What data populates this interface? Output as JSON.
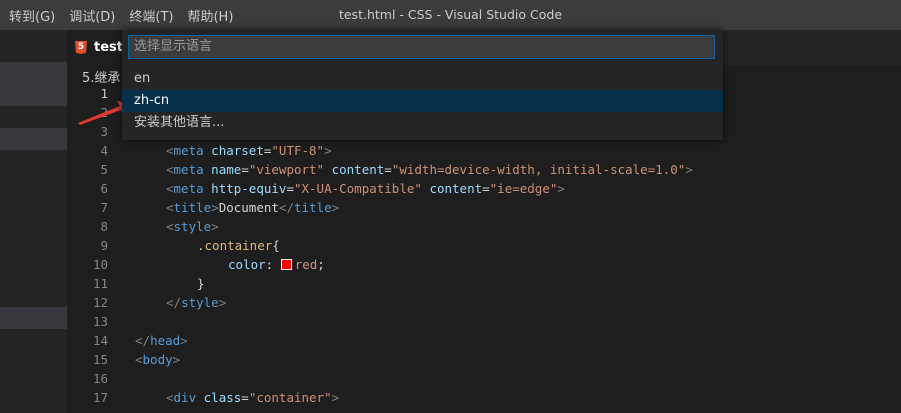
{
  "titlebar": {
    "menus": [
      "转到(G)",
      "调试(D)",
      "终端(T)",
      "帮助(H)"
    ],
    "title": "test.html - CSS - Visual Studio Code"
  },
  "tab": {
    "label": "test."
  },
  "breadcrumb": "5.继承",
  "picker": {
    "placeholder": "选择显示语言",
    "items": [
      "en",
      "zh-cn",
      "安装其他语言..."
    ],
    "focused_item": "zh-cn"
  },
  "editor": {
    "active_line": 1,
    "lines": [
      {
        "n": "1",
        "code": ""
      },
      {
        "n": "2",
        "code": ""
      },
      {
        "n": "3",
        "code": ""
      },
      {
        "n": "4",
        "indent": 1,
        "tag": "meta",
        "attrs": [
          [
            "charset",
            "\"UTF-8\""
          ]
        ]
      },
      {
        "n": "5",
        "indent": 1,
        "tag": "meta",
        "attrs": [
          [
            "name",
            "\"viewport\""
          ],
          [
            "content",
            "\"width=device-width, initial-scale=1.0\""
          ]
        ]
      },
      {
        "n": "6",
        "indent": 1,
        "tag": "meta",
        "attrs": [
          [
            "http-equiv",
            "\"X-UA-Compatible\""
          ],
          [
            "content",
            "\"ie=edge\""
          ]
        ]
      },
      {
        "n": "7",
        "indent": 1,
        "tag": "title",
        "inner": "Document",
        "close": "title"
      },
      {
        "n": "8",
        "indent": 1,
        "tag": "style"
      },
      {
        "n": "9",
        "indent": 2,
        "selector": ".container{"
      },
      {
        "n": "10",
        "indent": 3,
        "prop": "color",
        "value": "red"
      },
      {
        "n": "11",
        "indent": 2,
        "plain": "}"
      },
      {
        "n": "12",
        "indent": 1,
        "closetag": "style"
      },
      {
        "n": "13"
      },
      {
        "n": "14",
        "indent": 0,
        "closetag": "head"
      },
      {
        "n": "15",
        "indent": 0,
        "tag": "body"
      },
      {
        "n": "16"
      },
      {
        "n": "17",
        "indent": 1,
        "tag": "div",
        "attrs": [
          [
            "class",
            "\"container\""
          ]
        ]
      }
    ],
    "swatch_color": "#ff0000"
  }
}
